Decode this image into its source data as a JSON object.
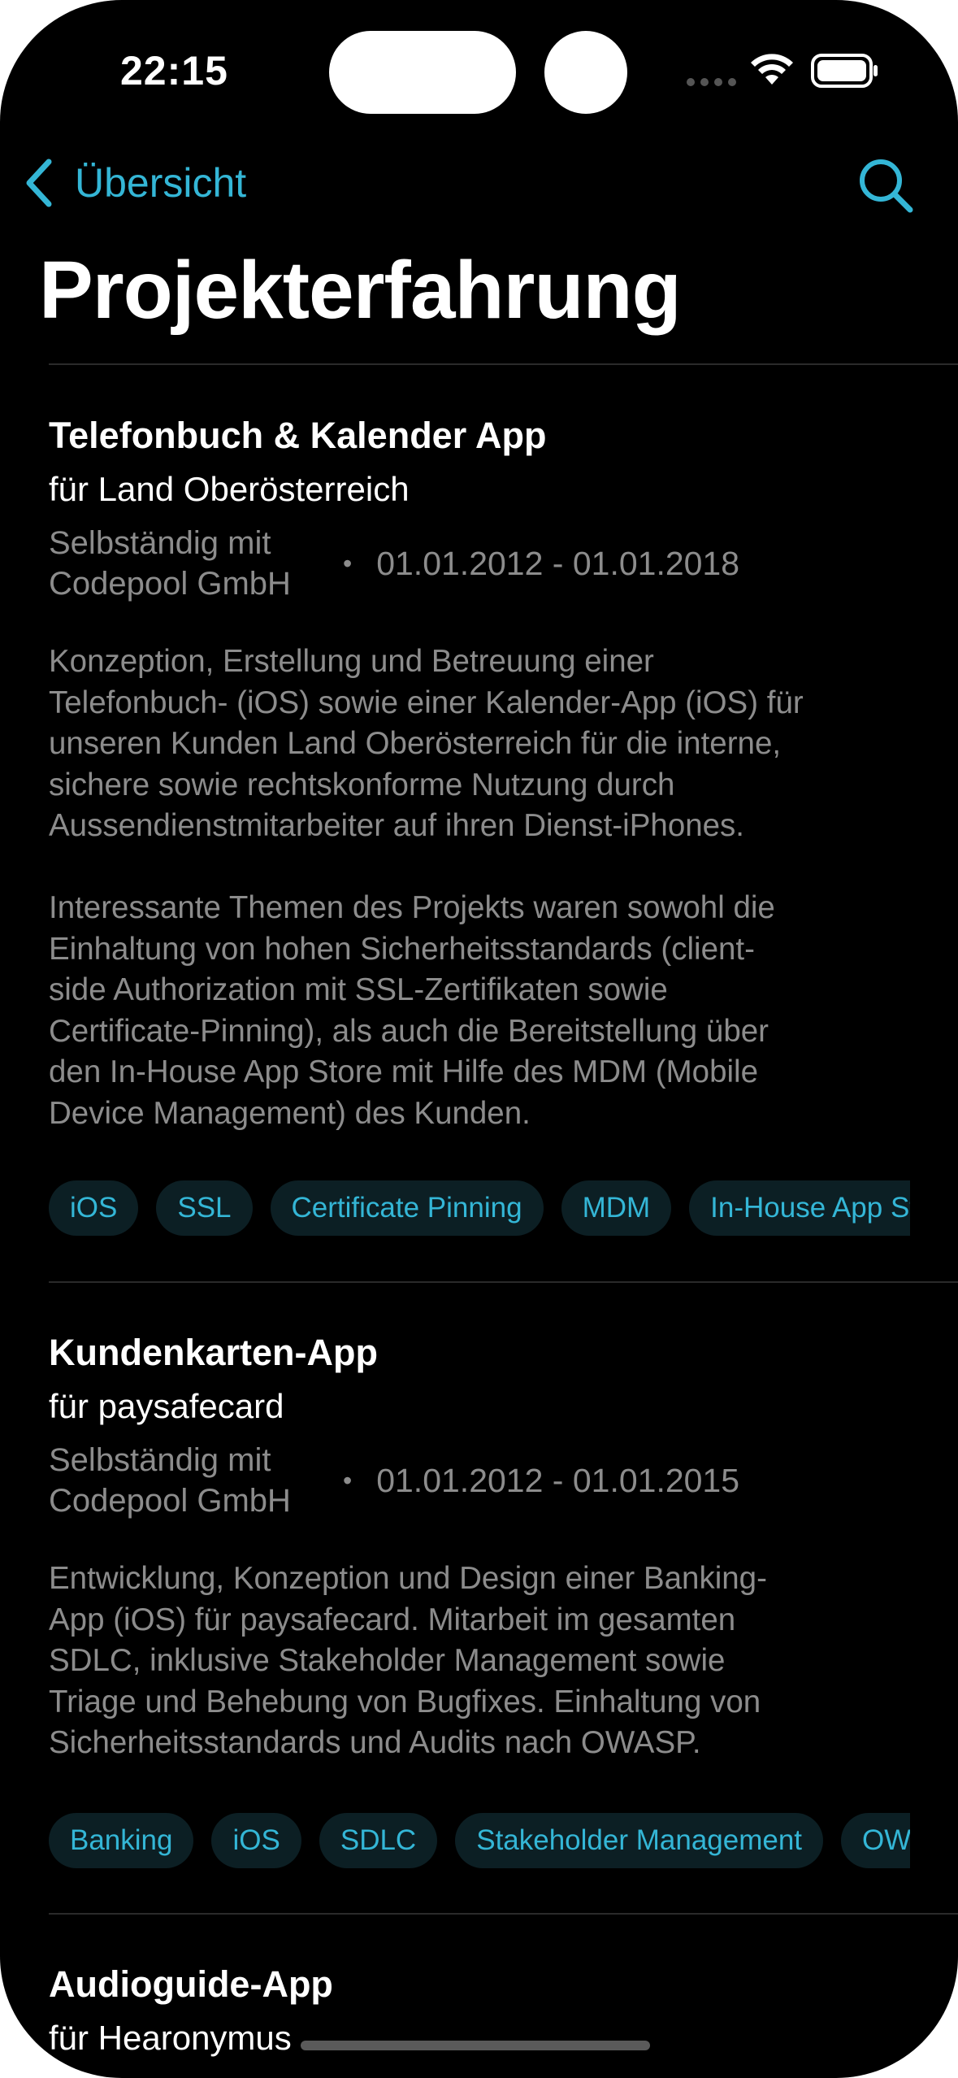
{
  "status_bar": {
    "time": "22:15"
  },
  "nav": {
    "back_label": "Übersicht",
    "title": "Projekterfahrung"
  },
  "projects": [
    {
      "title": "Telefonbuch & Kalender App",
      "client": "für Land Oberösterreich",
      "org": "Selbständig mit\nCodepool GmbH",
      "dates": "01.01.2012 - 01.01.2018",
      "description": "Konzeption, Erstellung und Betreuung einer\nTelefonbuch- (iOS) sowie einer Kalender-App (iOS) für\nunseren Kunden Land Oberösterreich für die interne,\nsichere sowie rechtskonforme Nutzung durch\nAussendienstmitarbeiter auf ihren Dienst-iPhones.\n\nInteressante Themen des Projekts waren sowohl die\nEinhaltung von hohen Sicherheitsstandards (client-\nside Authorization mit SSL-Zertifikaten sowie\nCertificate-Pinning), als auch die Bereitstellung über\nden In-House App Store mit Hilfe des MDM (Mobile\nDevice Management) des Kunden.",
      "tags": [
        "iOS",
        "SSL",
        "Certificate Pinning",
        "MDM",
        "In-House App Store"
      ]
    },
    {
      "title": "Kundenkarten-App",
      "client": "für paysafecard",
      "org": "Selbständig mit\nCodepool GmbH",
      "dates": "01.01.2012 - 01.01.2015",
      "description": "Entwicklung, Konzeption und Design einer Banking-\nApp (iOS) für paysafecard. Mitarbeit im gesamten\nSDLC, inklusive Stakeholder Management sowie\nTriage und Behebung von Bugfixes. Einhaltung von\nSicherheitsstandards und Audits nach OWASP.",
      "tags": [
        "Banking",
        "iOS",
        "SDLC",
        "Stakeholder Management",
        "OWASP"
      ]
    },
    {
      "title": "Audioguide-App",
      "client": "für Hearonymus"
    }
  ],
  "colors": {
    "accent": "#34b6d6",
    "background": "#000000",
    "secondary_text": "#8c8c8c",
    "tag_background": "#0c1f24"
  }
}
